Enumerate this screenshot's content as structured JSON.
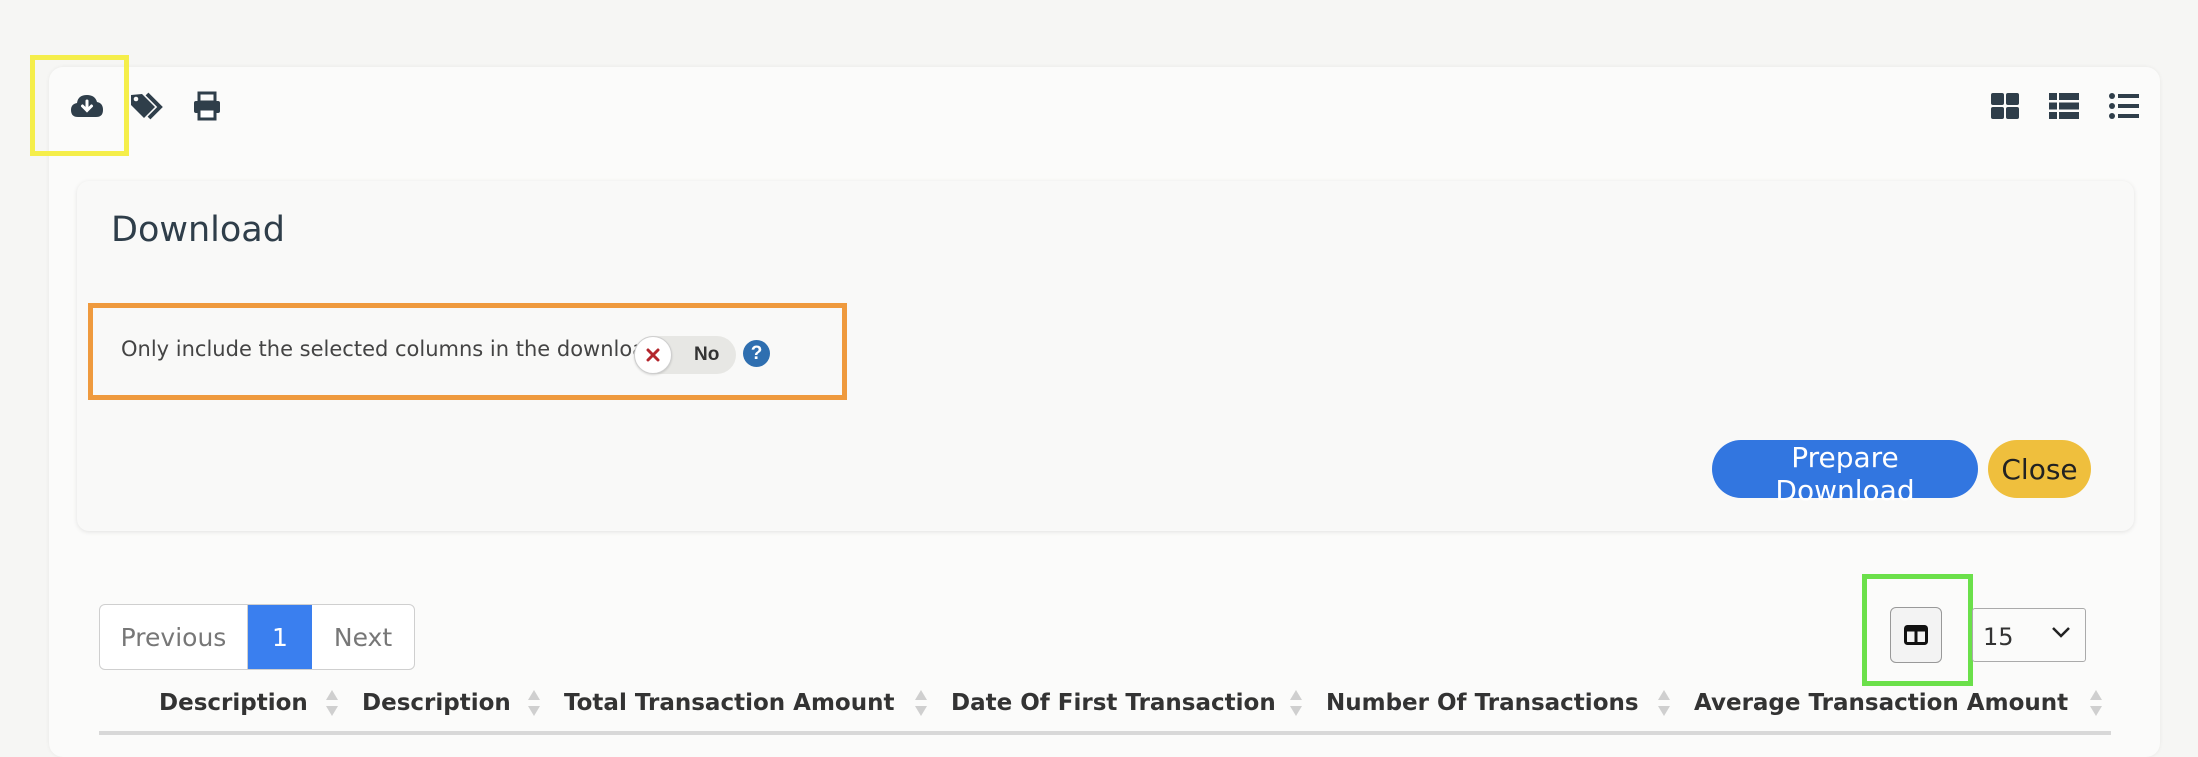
{
  "toolbar": {
    "left_icons": [
      "cloud-download-icon",
      "tags-icon",
      "print-icon"
    ],
    "right_icons": [
      "grid-view-icon",
      "list-view-icon",
      "detail-list-icon"
    ]
  },
  "download_panel": {
    "title": "Download",
    "option_label": "Only include the selected columns in the download",
    "toggle_value": "No",
    "toggle_state": false,
    "help_glyph": "?",
    "prepare_label": "Prepare Download",
    "close_label": "Close"
  },
  "pagination": {
    "previous_label": "Previous",
    "current_page": "1",
    "next_label": "Next"
  },
  "page_size": {
    "value": "15"
  },
  "table": {
    "headers": [
      "Description",
      "Description",
      "Total Transaction Amount",
      "Date Of First Transaction",
      "Number Of Transactions",
      "Average Transaction Amount"
    ]
  },
  "colors": {
    "primary": "#3276e0",
    "warning": "#efbf3d",
    "highlight_yellow": "#f5ee4a",
    "highlight_orange": "#ef9a3e",
    "highlight_green": "#6be04a"
  }
}
